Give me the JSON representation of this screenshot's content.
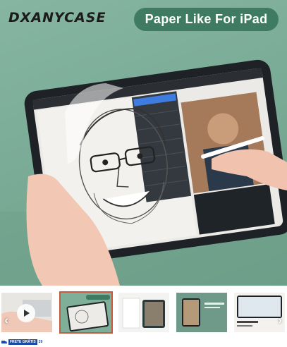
{
  "hero": {
    "brand": "DXANYCASE",
    "badge": "Paper Like For iPad"
  },
  "thumbnails": {
    "items": [
      {
        "name": "thumb-video",
        "kind": "video"
      },
      {
        "name": "thumb-2",
        "kind": "image",
        "active": true
      },
      {
        "name": "thumb-3",
        "kind": "image"
      },
      {
        "name": "thumb-4",
        "kind": "image"
      },
      {
        "name": "thumb-5",
        "kind": "image"
      }
    ],
    "shipping": {
      "line1": "FRETE",
      "line2": "GRÁTIS",
      "amount": "29"
    }
  },
  "colors": {
    "background": "#78a994",
    "badge": "#3f7b62",
    "active_outline": "#c65a3e"
  }
}
